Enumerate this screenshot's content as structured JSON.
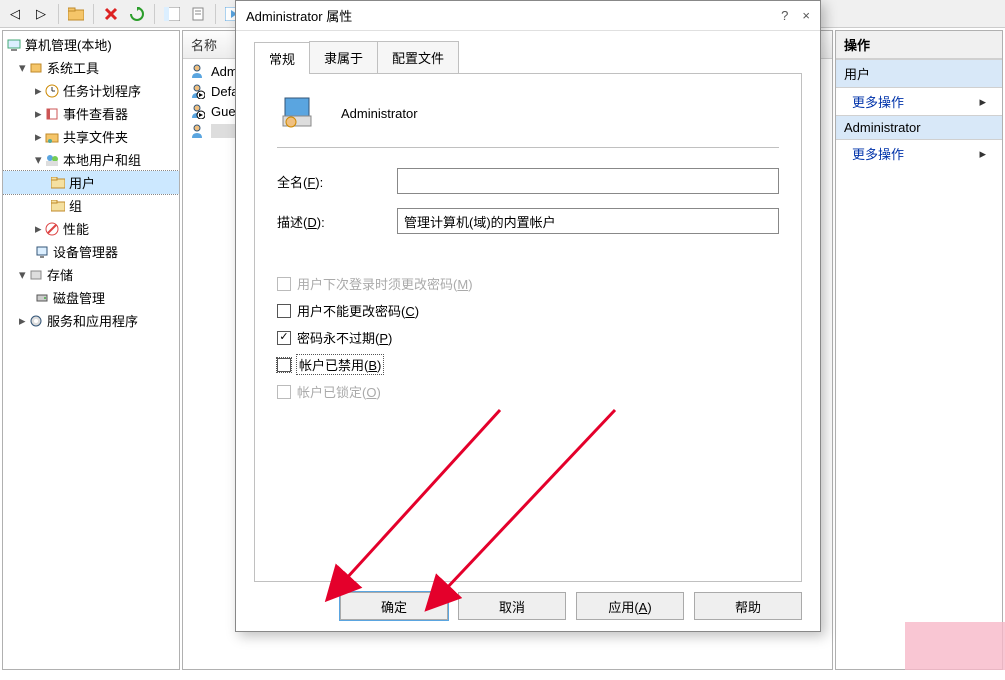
{
  "toolbar": {
    "icons": [
      "nav-back",
      "nav-fwd",
      "folder",
      "close-red",
      "refresh-green",
      "tree-toggle",
      "properties",
      "play",
      "grid"
    ]
  },
  "tree": {
    "root": "算机管理(本地)",
    "system_tools": "系统工具",
    "task_scheduler": "任务计划程序",
    "event_viewer": "事件查看器",
    "shared_folders": "共享文件夹",
    "local_users_groups": "本地用户和组",
    "users": "用户",
    "groups": "组",
    "performance": "性能",
    "device_manager": "设备管理器",
    "storage": "存储",
    "disk_management": "磁盘管理",
    "services_apps": "服务和应用程序"
  },
  "list": {
    "header": "名称",
    "items": [
      "Administrator",
      "DefaultAccount",
      "Guest",
      ""
    ]
  },
  "right": {
    "title": "操作",
    "section1": "用户",
    "more1": "更多操作",
    "section2": "Administrator",
    "more2": "更多操作"
  },
  "dialog": {
    "title": "Administrator 属性",
    "help": "?",
    "close": "×",
    "tabs": {
      "general": "常规",
      "memberof": "隶属于",
      "profile": "配置文件"
    },
    "username": "Administrator",
    "fullname_label": "全名(F):",
    "fullname_value": "",
    "desc_label": "描述(D):",
    "desc_value": "管理计算机(域)的内置帐户",
    "checks": {
      "must_change": "用户下次登录时须更改密码(M)",
      "cannot_change": "用户不能更改密码(C)",
      "never_expire": "密码永不过期(P)",
      "disabled": "帐户已禁用(B)",
      "locked": "帐户已锁定(O)"
    },
    "buttons": {
      "ok": "确定",
      "cancel": "取消",
      "apply": "应用(A)",
      "help": "帮助"
    }
  }
}
